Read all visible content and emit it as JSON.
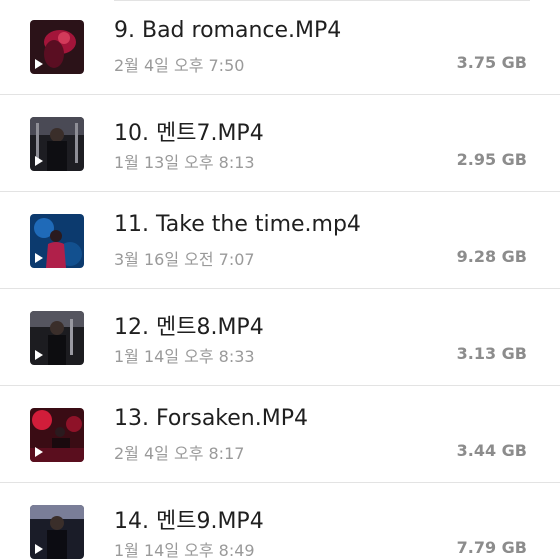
{
  "files": [
    {
      "name": "9. Bad romance.MP4",
      "date": "2월 4일 오후 7:50",
      "size": "3.75 GB",
      "thumb_icon": "video-thumbnail-icon",
      "thumb_colors": {
        "bg": "#2b1218",
        "fg": "#a3153a"
      }
    },
    {
      "name": "10. 멘트7.MP4",
      "date": "1월 13일 오후 8:13",
      "size": "2.95 GB",
      "thumb_icon": "video-thumbnail-icon",
      "thumb_colors": {
        "bg": "#1d1d22",
        "fg": "#8e8e96"
      }
    },
    {
      "name": "11. Take the time.mp4",
      "date": "3월 16일 오전 7:07",
      "size": "9.28 GB",
      "thumb_icon": "video-thumbnail-icon",
      "thumb_colors": {
        "bg": "#0c3a6e",
        "fg": "#b0204a"
      }
    },
    {
      "name": "12. 멘트8.MP4",
      "date": "1월 14일 오후 8:33",
      "size": "3.13 GB",
      "thumb_icon": "video-thumbnail-icon",
      "thumb_colors": {
        "bg": "#1c1c20",
        "fg": "#9a9aa2"
      }
    },
    {
      "name": "13. Forsaken.MP4",
      "date": "2월 4일 오후 8:17",
      "size": "3.44 GB",
      "thumb_icon": "video-thumbnail-icon",
      "thumb_colors": {
        "bg": "#3a0c14",
        "fg": "#d11d3a"
      }
    },
    {
      "name": "14. 멘트9.MP4",
      "date": "1월 14일 오후 8:49",
      "size": "7.79 GB",
      "thumb_icon": "video-thumbnail-icon",
      "thumb_colors": {
        "bg": "#1a1c28",
        "fg": "#7a7e98"
      }
    }
  ]
}
